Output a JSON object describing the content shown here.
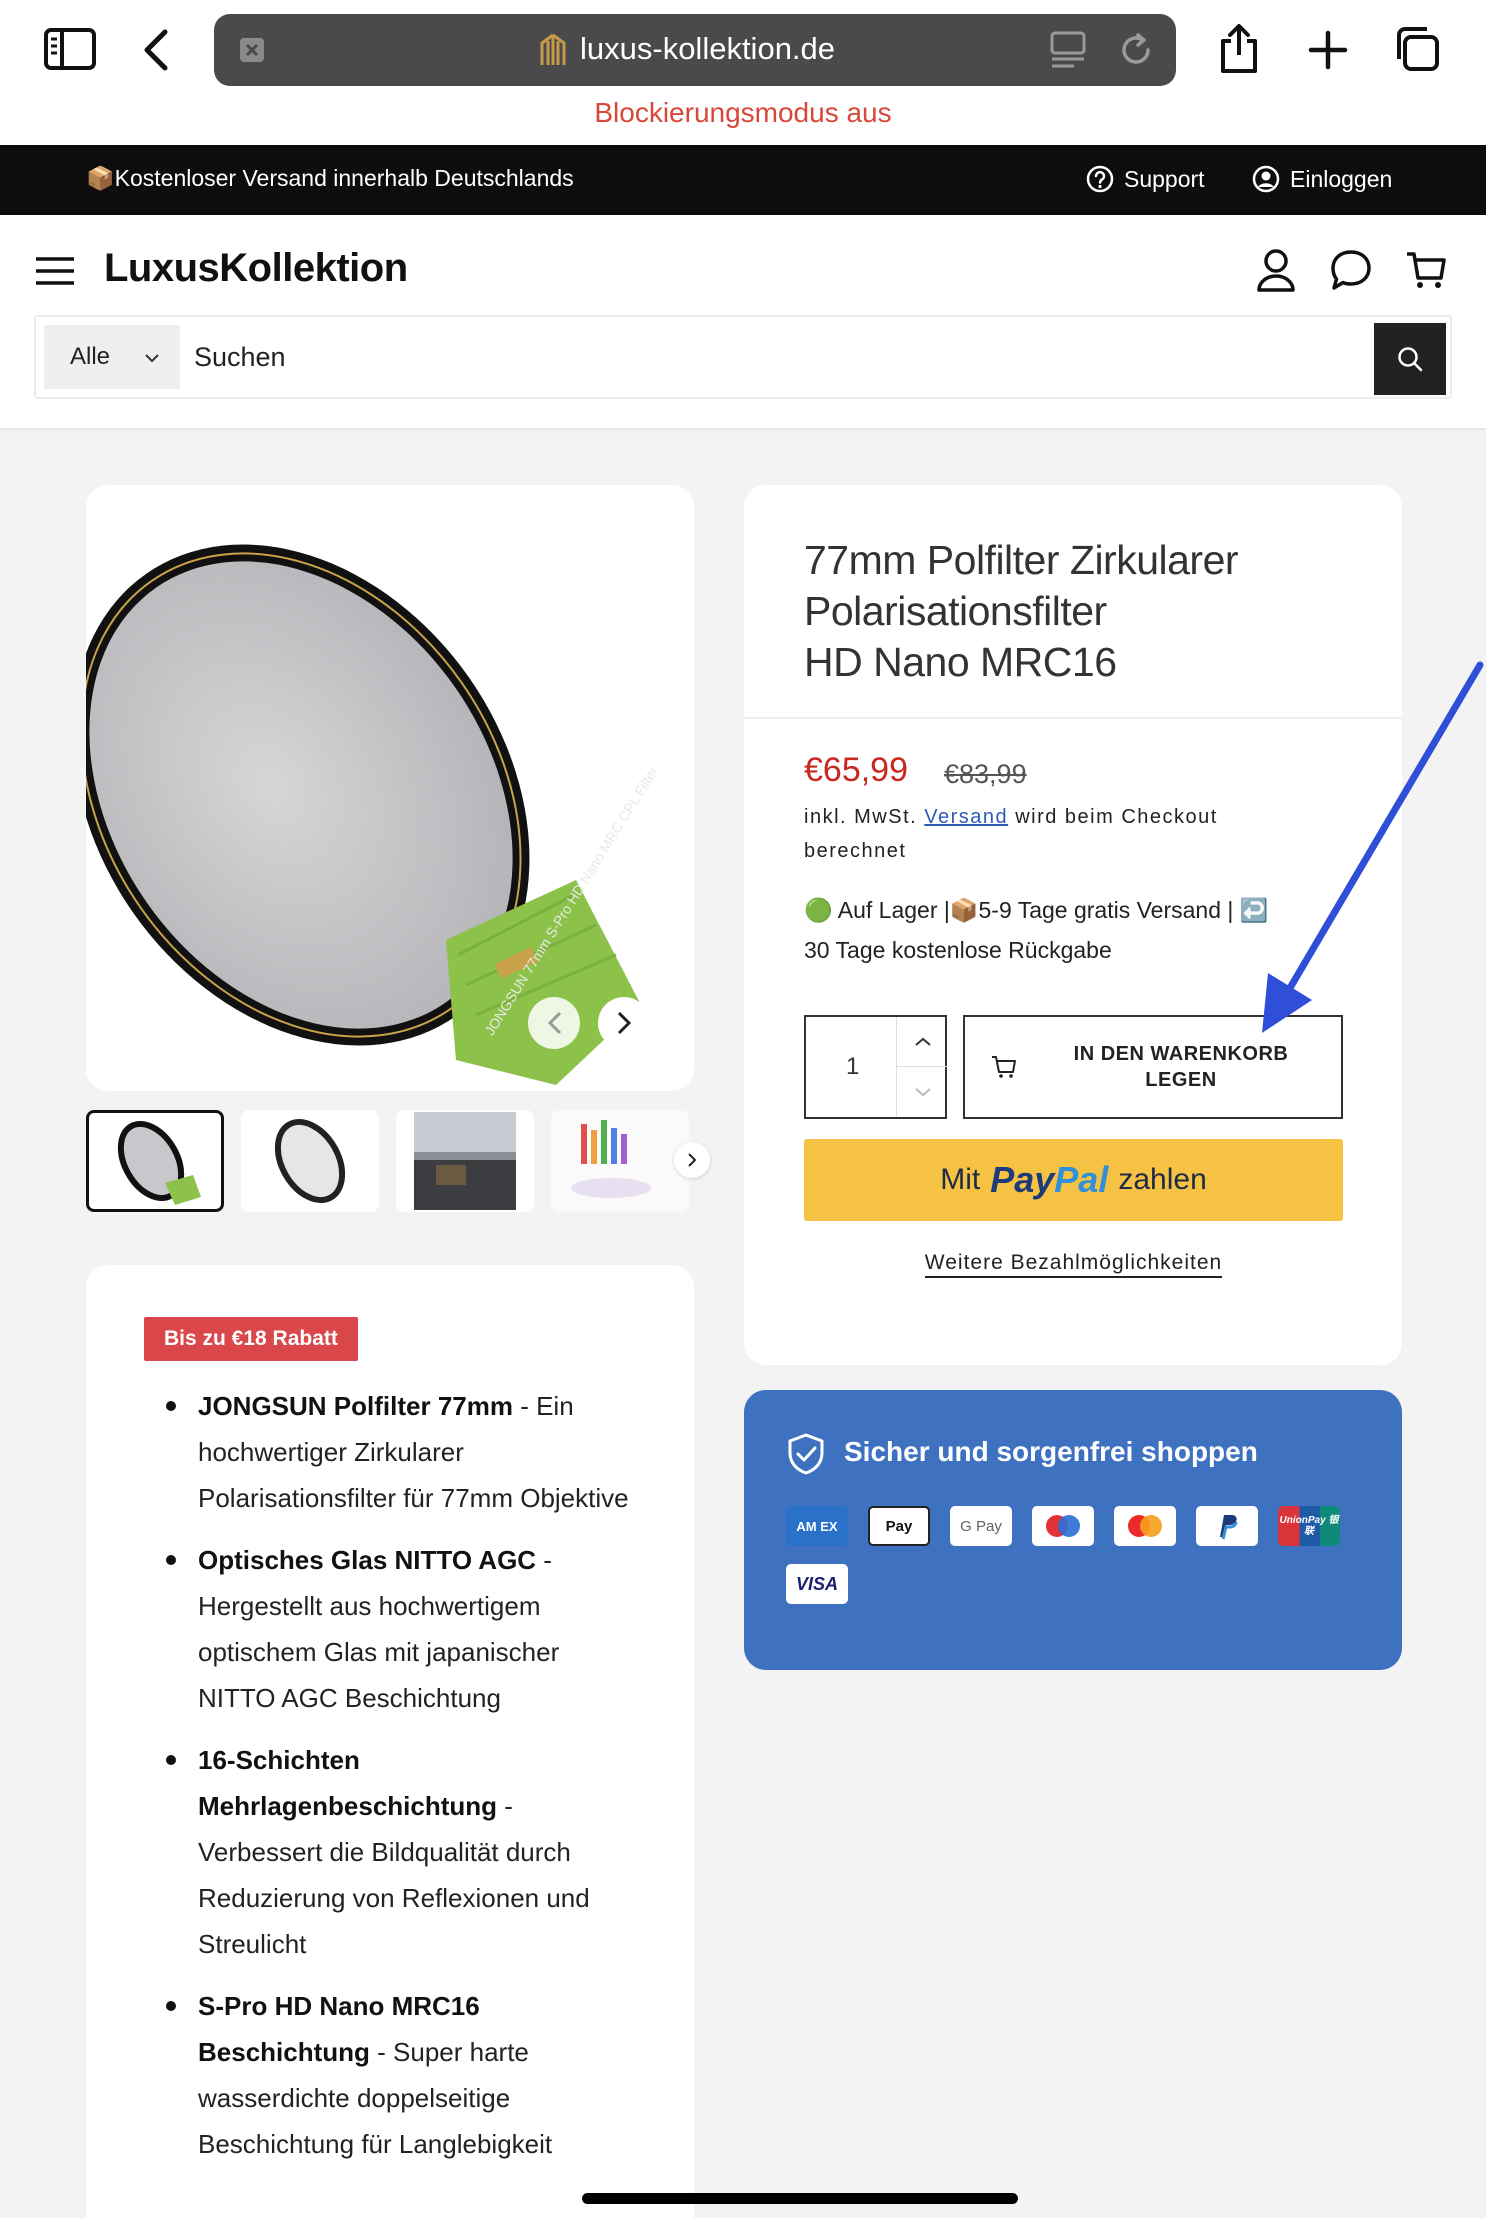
{
  "browser": {
    "url": "luxus-kollektion.de",
    "lock_mode": "Blockierungsmodus aus"
  },
  "announcement": {
    "shipping_text": "📦Kostenloser Versand innerhalb Deutschlands",
    "support_label": "Support",
    "login_label": "Einloggen"
  },
  "header": {
    "logo": "LuxusKollektion",
    "search": {
      "category": "Alle",
      "placeholder": "Suchen"
    }
  },
  "product": {
    "title_line1": "77mm Polfilter Zirkularer",
    "title_line2": "Polarisationsfilter",
    "title_line3": "HD Nano MRC16",
    "price": "€65,99",
    "old_price": "€83,99",
    "tax_prefix": "inkl. MwSt.",
    "tax_link": "Versand",
    "tax_suffix": "wird beim Checkout berechnet",
    "stock_line1": "🟢 Auf Lager |📦5-9 Tage gratis Versand | ↩️",
    "stock_line2": "30 Tage kostenlose Rückgabe",
    "quantity": "1",
    "cart_button": "IN DEN WARENKORB LEGEN",
    "paypal_prefix": "Mit",
    "paypal_brand1": "Pay",
    "paypal_brand2": "Pal",
    "paypal_suffix": "zahlen",
    "more_payments": "Weitere Bezahlmöglichkeiten"
  },
  "trust": {
    "title": "Sicher und sorgenfrei shoppen",
    "payment_methods": [
      "American Express",
      "Apple Pay",
      "Google Pay",
      "Maestro",
      "Mastercard",
      "PayPal",
      "UnionPay",
      "Visa"
    ],
    "labels": {
      "amex": "AM EX",
      "applepay": "Pay",
      "googlepay": "G Pay",
      "unionpay": "UnionPay 银联",
      "visa": "VISA"
    }
  },
  "description": {
    "badge": "Bis zu €18 Rabatt",
    "bullets": [
      {
        "bold": "JONGSUN Polfilter 77mm",
        "text": " - Ein hochwertiger Zirkularer Polarisationsfilter für 77mm Objektive"
      },
      {
        "bold": "Optisches Glas NITTO AGC",
        "text": " - Hergestellt aus hochwertigem optischem Glas mit japanischer NITTO AGC Beschichtung"
      },
      {
        "bold": "16-Schichten Mehrlagenbeschichtung",
        "text": " - Verbessert die Bildqualität durch Reduzierung von Reflexionen und Streulicht"
      },
      {
        "bold": "S-Pro HD Nano MRC16 Beschichtung",
        "text": " - Super harte wasserdichte doppelseitige Beschichtung für Langlebigkeit"
      }
    ]
  },
  "filter_print": "JONGSUN 77mm S-Pro HD Nano MRC CPL Filter",
  "colors": {
    "accent_price": "#c8281e",
    "paypal_yellow": "#f6c244",
    "trust_blue": "#3e72c0",
    "badge_red": "#d9474a",
    "annotation_arrow": "#2f4fd8"
  }
}
